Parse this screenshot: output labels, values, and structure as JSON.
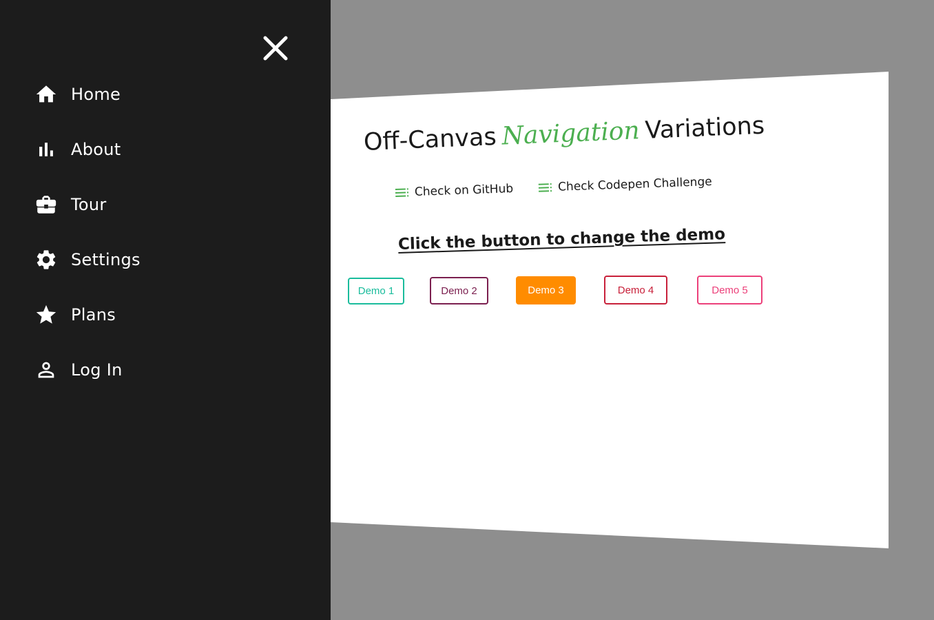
{
  "sidebar": {
    "close_icon": "close-icon",
    "items": [
      {
        "label": "Home",
        "icon": "home-icon"
      },
      {
        "label": "About",
        "icon": "bar-chart-icon"
      },
      {
        "label": "Tour",
        "icon": "briefcase-icon"
      },
      {
        "label": "Settings",
        "icon": "gear-icon"
      },
      {
        "label": "Plans",
        "icon": "star-icon"
      },
      {
        "label": "Log In",
        "icon": "user-icon"
      }
    ]
  },
  "main": {
    "title": {
      "before": "Off-Canvas",
      "accent": "Navigation",
      "after": "Variations"
    },
    "links": [
      {
        "label": "Check on GitHub",
        "icon": "list-icon"
      },
      {
        "label": "Check Codepen Challenge",
        "icon": "list-icon"
      }
    ],
    "cta": "Click the button to change the demo",
    "demos": [
      {
        "label": "Demo 1",
        "color": "#1abc9c",
        "active": false
      },
      {
        "label": "Demo 2",
        "color": "#7b1f4f",
        "active": false
      },
      {
        "label": "Demo 3",
        "color": "#ff8c00",
        "active": true
      },
      {
        "label": "Demo 4",
        "color": "#c8203a",
        "active": false
      },
      {
        "label": "Demo 5",
        "color": "#ec407a",
        "active": false
      }
    ]
  },
  "colors": {
    "sidebar_bg": "#1c1c1c",
    "page_bg": "#ffffff",
    "backdrop": "#8e8e8e",
    "accent_green": "#4caf50"
  }
}
